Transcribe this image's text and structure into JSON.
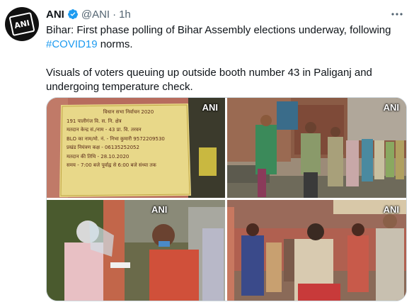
{
  "account": {
    "name": "ANI",
    "handle": "@ANI",
    "separator": "·",
    "time": "1h",
    "avatar_text": "ANI"
  },
  "tweet": {
    "line1_before_tag": "Bihar: First phase polling of Bihar Assembly elections underway, following ",
    "hashtag": "#COVID19",
    "line1_after_tag": " norms.",
    "paragraph2": "Visuals of voters queuing up outside booth number 43 in Paliganj and undergoing temperature check."
  },
  "media": {
    "watermark": "ANI",
    "sign": {
      "line1": "विधान सभा निर्वाचन 2020",
      "line2": "191 पालीगंज वि. स. नि. क्षेत्र",
      "line3": "मतदान केन्द्र सं./नाम - 43 प्रा. वि. तरवन",
      "line4": "BLO का नाम/मो. नं. - निभा कुमारी 9572209530",
      "line5": "प्रखंड नियंत्रण कक्ष - 06135252052",
      "line6": "मतदान की तिथि - 28.10.2020",
      "line7": "समय - 7:00 बजे पूर्वाह्न से 6:00 बजे संध्या तक"
    }
  },
  "icons": {
    "verified": "verified-badge-icon",
    "more": "more-options-icon"
  },
  "colors": {
    "link": "#1d9bf0",
    "verified": "#1d9bf0",
    "secondary_text": "#536471",
    "border": "#cfd9de"
  }
}
